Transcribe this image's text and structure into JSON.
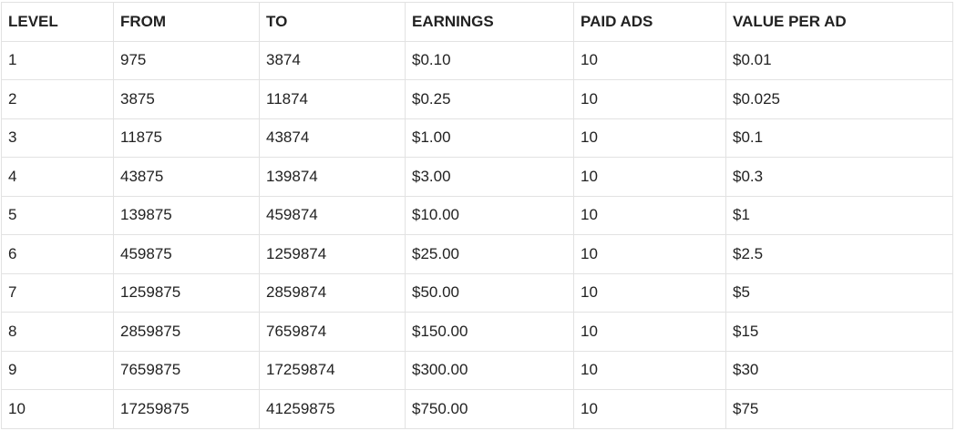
{
  "table": {
    "headers": [
      "LEVEL",
      "FROM",
      "TO",
      "EARNINGS",
      "PAID ADS",
      "VALUE PER AD"
    ],
    "rows": [
      [
        "1",
        "975",
        "3874",
        "$0.10",
        "10",
        "$0.01"
      ],
      [
        "2",
        "3875",
        "11874",
        "$0.25",
        "10",
        "$0.025"
      ],
      [
        "3",
        "11875",
        "43874",
        "$1.00",
        "10",
        "$0.1"
      ],
      [
        "4",
        "43875",
        "139874",
        "$3.00",
        "10",
        "$0.3"
      ],
      [
        "5",
        "139875",
        "459874",
        "$10.00",
        "10",
        "$1"
      ],
      [
        "6",
        "459875",
        "1259874",
        "$25.00",
        "10",
        "$2.5"
      ],
      [
        "7",
        "1259875",
        "2859874",
        "$50.00",
        "10",
        "$5"
      ],
      [
        "8",
        "2859875",
        "7659874",
        "$150.00",
        "10",
        "$15"
      ],
      [
        "9",
        "7659875",
        "17259874",
        "$300.00",
        "10",
        "$30"
      ],
      [
        "10",
        "17259875",
        "41259875",
        "$750.00",
        "10",
        "$75"
      ]
    ]
  },
  "colors": {
    "text": "#222222",
    "border": "#e2e2e2",
    "background": "#ffffff"
  }
}
